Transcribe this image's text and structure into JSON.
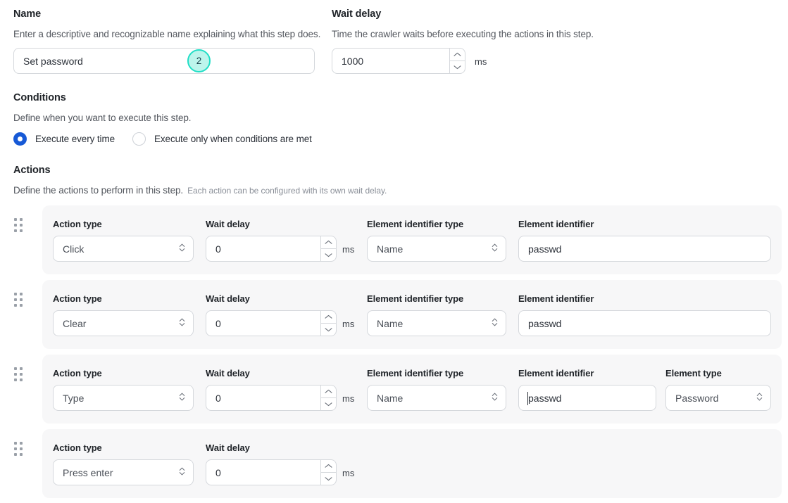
{
  "name_section": {
    "label": "Name",
    "description": "Enter a descriptive and recognizable name explaining what this step does.",
    "value": "Set password",
    "badge": "2"
  },
  "wait_delay_section": {
    "label": "Wait delay",
    "description": "Time the crawler waits before executing the actions in this step.",
    "value": "1000",
    "unit": "ms"
  },
  "conditions_section": {
    "label": "Conditions",
    "description": "Define when you want to execute this step.",
    "options": [
      {
        "label": "Execute every time",
        "selected": true
      },
      {
        "label": "Execute only when conditions are met",
        "selected": false
      }
    ]
  },
  "actions_section": {
    "label": "Actions",
    "description": "Define the actions to perform in this step.",
    "description_sub": "Each action can be configured with its own wait delay.",
    "column_labels": {
      "action_type": "Action type",
      "wait_delay": "Wait delay",
      "element_identifier_type": "Element identifier type",
      "element_identifier": "Element identifier",
      "element_type": "Element type"
    },
    "unit": "ms",
    "rows": [
      {
        "action_type": "Click",
        "wait_delay": "0",
        "element_identifier_type": "Name",
        "element_identifier": "passwd",
        "element_type": null
      },
      {
        "action_type": "Clear",
        "wait_delay": "0",
        "element_identifier_type": "Name",
        "element_identifier": "passwd",
        "element_type": null
      },
      {
        "action_type": "Type",
        "wait_delay": "0",
        "element_identifier_type": "Name",
        "element_identifier": "passwd",
        "element_type": "Password"
      },
      {
        "action_type": "Press enter",
        "wait_delay": "0",
        "element_identifier_type": null,
        "element_identifier": null,
        "element_type": null
      }
    ]
  },
  "colors": {
    "accent_blue": "#1659d6",
    "badge_fill": "#bdf5ec",
    "badge_border": "#21dec6",
    "card_bg": "#f7f7f8",
    "border": "#d5d8dc"
  }
}
